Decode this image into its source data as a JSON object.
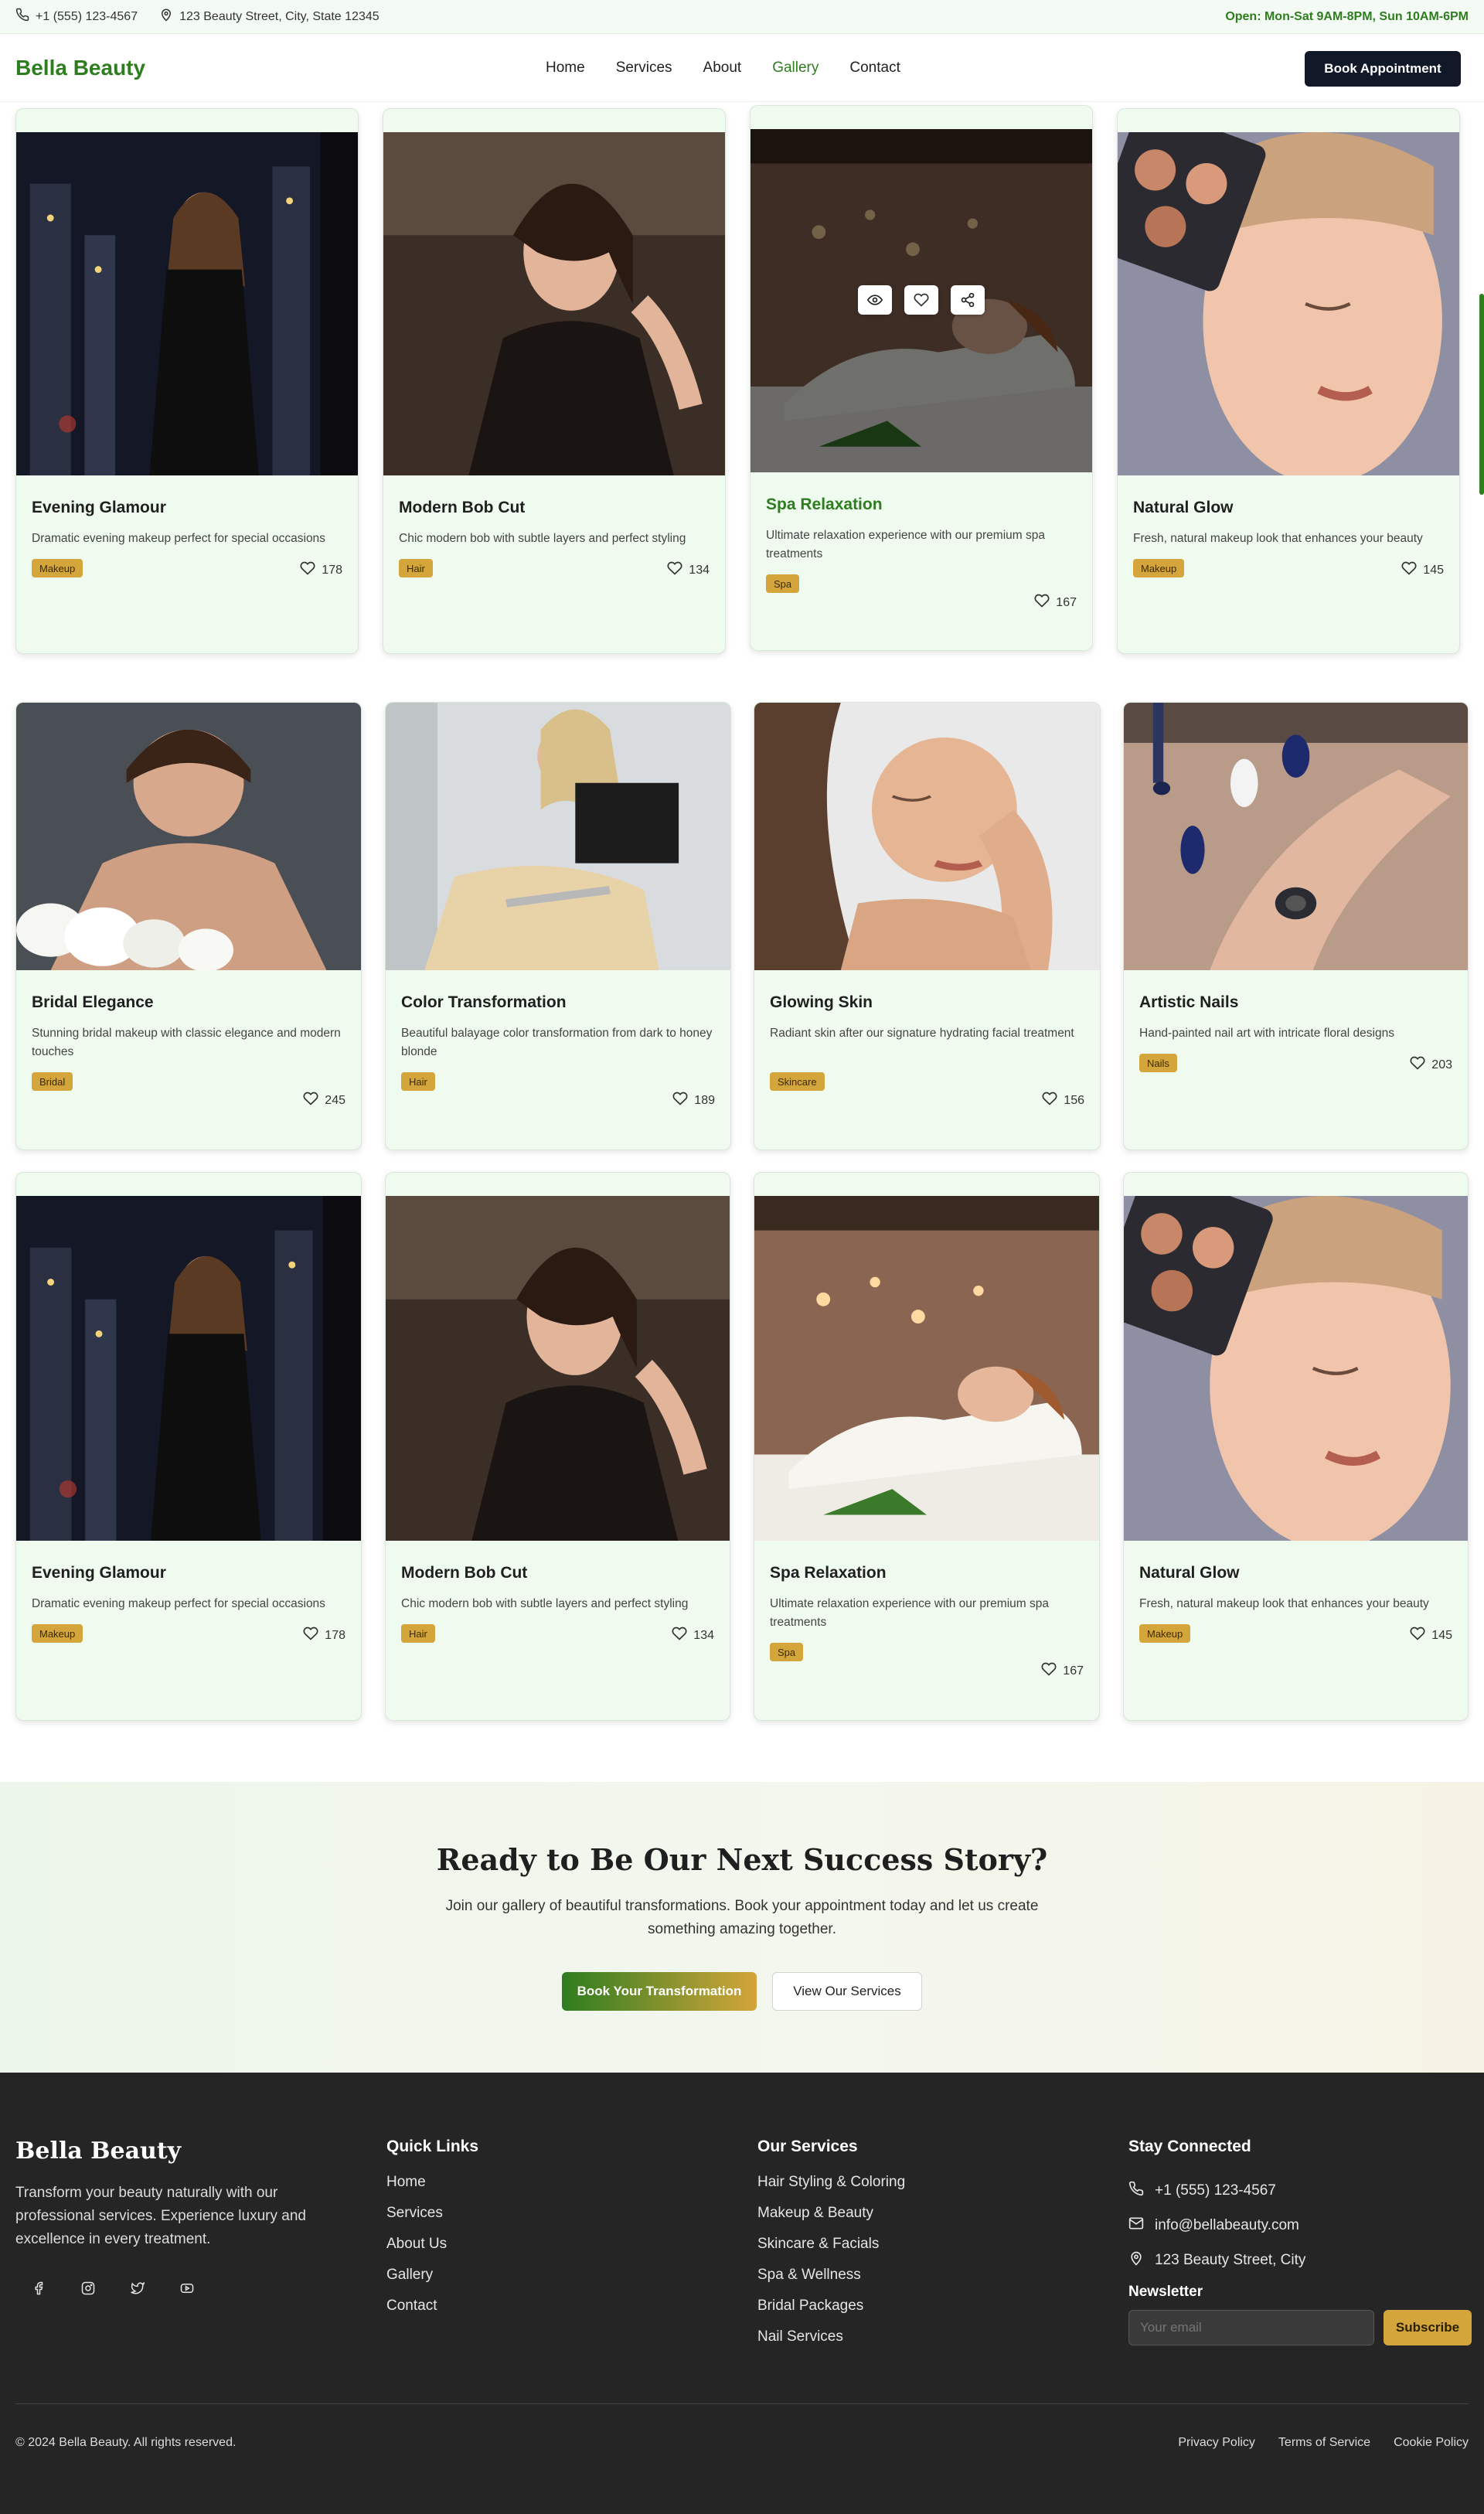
{
  "topbar": {
    "phone": "+1 (555) 123-4567",
    "address": "123 Beauty Street, City, State 12345",
    "hours": "Open: Mon-Sat 9AM-8PM, Sun 10AM-6PM"
  },
  "nav": {
    "brand": "Bella Beauty",
    "links": [
      "Home",
      "Services",
      "About",
      "Gallery",
      "Contact"
    ],
    "active": "Gallery",
    "cta": "Book Appointment"
  },
  "gallery": [
    {
      "title": "Evening Glamour",
      "desc": "Dramatic evening makeup perfect for special occasions",
      "tag": "Makeup",
      "likes": "178",
      "image": "evening-glamour-photo"
    },
    {
      "title": "Modern Bob Cut",
      "desc": "Chic modern bob with subtle layers and perfect styling",
      "tag": "Hair",
      "likes": "134",
      "image": "modern-bob-photo"
    },
    {
      "title": "Spa Relaxation",
      "desc": "Ultimate relaxation experience with our premium spa treatments",
      "tag": "Spa",
      "likes": "167",
      "image": "spa-relaxation-photo",
      "hovered": true
    },
    {
      "title": "Natural Glow",
      "desc": "Fresh, natural makeup look that enhances your beauty",
      "tag": "Makeup",
      "likes": "145",
      "image": "natural-glow-photo"
    },
    {
      "title": "Bridal Elegance",
      "desc": "Stunning bridal makeup with classic elegance and modern touches",
      "tag": "Bridal",
      "likes": "245",
      "image": "bridal-elegance-photo"
    },
    {
      "title": "Color Transformation",
      "desc": "Beautiful balayage color transformation from dark to honey blonde",
      "tag": "Hair",
      "likes": "189",
      "image": "color-transformation-photo"
    },
    {
      "title": "Glowing Skin",
      "desc": "Radiant skin after our signature hydrating facial treatment",
      "tag": "Skincare",
      "likes": "156",
      "image": "glowing-skin-photo"
    },
    {
      "title": "Artistic Nails",
      "desc": "Hand-painted nail art with intricate floral designs",
      "tag": "Nails",
      "likes": "203",
      "image": "artistic-nails-photo"
    },
    {
      "title": "Evening Glamour",
      "desc": "Dramatic evening makeup perfect for special occasions",
      "tag": "Makeup",
      "likes": "178",
      "image": "evening-glamour-photo"
    },
    {
      "title": "Modern Bob Cut",
      "desc": "Chic modern bob with subtle layers and perfect styling",
      "tag": "Hair",
      "likes": "134",
      "image": "modern-bob-photo"
    },
    {
      "title": "Spa Relaxation",
      "desc": "Ultimate relaxation experience with our premium spa treatments",
      "tag": "Spa",
      "likes": "167",
      "image": "spa-relaxation-photo"
    },
    {
      "title": "Natural Glow",
      "desc": "Fresh, natural makeup look that enhances your beauty",
      "tag": "Makeup",
      "likes": "145",
      "image": "natural-glow-photo"
    }
  ],
  "cta": {
    "title": "Ready to Be Our Next Success Story?",
    "text": "Join our gallery of beautiful transformations. Book your appointment today and let us create something amazing together.",
    "primary": "Book Your Transformation",
    "secondary": "View Our Services"
  },
  "footer": {
    "brand": "Bella Beauty",
    "about": "Transform your beauty naturally with our professional services. Experience luxury and excellence in every treatment.",
    "quick_links_title": "Quick Links",
    "quick_links": [
      "Home",
      "Services",
      "About Us",
      "Gallery",
      "Contact"
    ],
    "services_title": "Our Services",
    "services": [
      "Hair Styling & Coloring",
      "Makeup & Beauty",
      "Skincare & Facials",
      "Spa & Wellness",
      "Bridal Packages",
      "Nail Services"
    ],
    "connect_title": "Stay Connected",
    "phone": "+1 (555) 123-4567",
    "email": "info@bellabeauty.com",
    "address": "123 Beauty Street, City",
    "newsletter_title": "Newsletter",
    "newsletter_placeholder": "Your email",
    "subscribe": "Subscribe",
    "copyright": "© 2024 Bella Beauty. All rights reserved.",
    "legal": [
      "Privacy Policy",
      "Terms of Service",
      "Cookie Policy"
    ]
  },
  "colors": {
    "brand_green": "#2e7d1f",
    "gold": "#d4a53a",
    "card_bg": "#effbef",
    "dark": "#111827",
    "footer_bg": "#252525"
  }
}
